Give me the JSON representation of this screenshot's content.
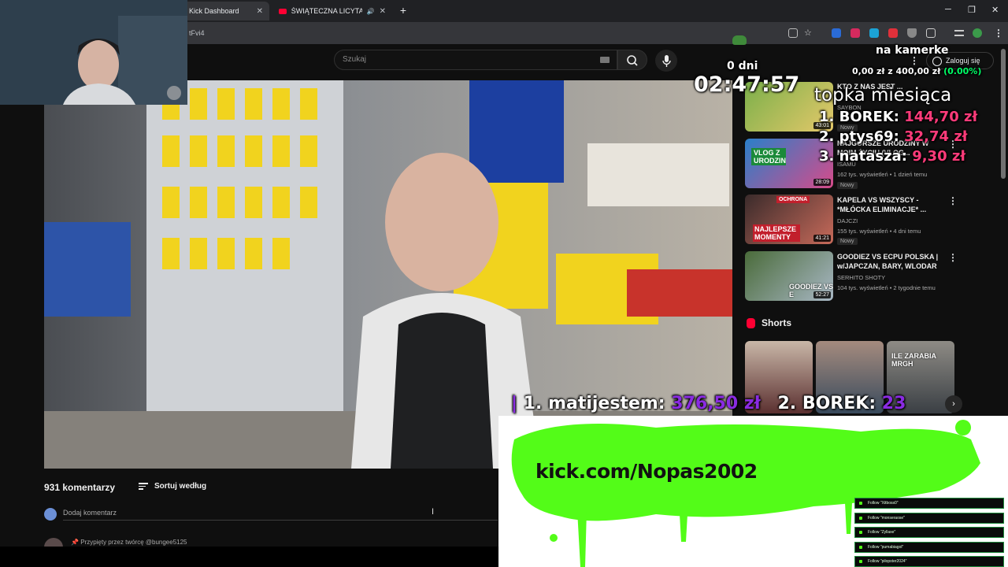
{
  "browser": {
    "tabs": [
      {
        "label": "Kick Dashboard",
        "active": true
      },
      {
        "label": "ŚWIĄTECZNA LICYTACJA P",
        "active": false
      }
    ],
    "address_fragment": "tFvi4"
  },
  "youtube": {
    "search_placeholder": "Szukaj",
    "login_label": "Zaloguj się",
    "comments": {
      "count_label": "931 komentarzy",
      "sort_label": "Sortuj według",
      "add_placeholder": "Dodaj komentarz",
      "pinned_label": "Przypięty przez twórcę @bungee5125"
    },
    "sidebar_videos": [
      {
        "title": "KTO Z NAS JEST ...",
        "channel": "SAYBON",
        "meta": "",
        "badge": "Nowy",
        "duration": "43:01"
      },
      {
        "title": "NAJGORSZE URODZINY W MOIM ŻYCIU (VLOG...",
        "channel": "ISAMU",
        "meta": "162 tys. wyświetleń • 1 dzień temu",
        "badge": "Nowy",
        "duration": "28:09"
      },
      {
        "title": "KAPELA VS WSZYSCY - *MŁÓCKA ELIMINACJE* ...",
        "channel": "DAJCZI",
        "meta": "155 tys. wyświetleń • 4 dni temu",
        "badge": "Nowy",
        "duration": "41:21"
      },
      {
        "title": "GOODIEZ VS ECPU POLSKA | w/JAPCZAN, BARY, WLODAR",
        "channel": "SERHITO SHOTY",
        "meta": "104 tys. wyświetleń • 2 tygodnie temu",
        "badge": "",
        "duration": "52:27"
      }
    ],
    "thumb_texts": [
      "VLOG Z URODZIN",
      "OCHRONA",
      "NAJLEPSZE MOMENTY",
      "GOODIEZ VS E"
    ],
    "shorts_label": "Shorts",
    "short_texts": [
      "",
      "",
      "ILE ZARABIA MRGH"
    ]
  },
  "overlay": {
    "goal_title": "na kamerke",
    "goal_progress": "0,00 zł z 400,00 zł",
    "goal_percent": "(0.00%)",
    "goal_fraction": 0.0,
    "timer_days": "0 dni",
    "timer": "02:47:57",
    "top_title": "topka miesiąca",
    "top_list": [
      {
        "rank": "1.",
        "name": "BOREK:",
        "amount": "144,70 zł"
      },
      {
        "rank": "2.",
        "name": "ptys69:",
        "amount": "32,74 zł"
      },
      {
        "rank": "3.",
        "name": "nataszа:",
        "amount": "9,30 zł"
      }
    ],
    "ticker": [
      {
        "rank": "1.",
        "name": "matijestem:",
        "amount": "376,50 zł"
      },
      {
        "rank": "2.",
        "name": "BOREK:",
        "amount": "23"
      }
    ],
    "kick_url": "kick.com/Nopas2002",
    "follow_feed": [
      "Follow \"Xitboss0\"",
      "Follow \"monseraose\"",
      "Follow \"Zyllaxe\"",
      "Follow \"pumabiagol\"",
      "Follow \"pilopster2024\""
    ]
  },
  "colors": {
    "kick_green": "#53fc18",
    "overlay_green": "#00ff66",
    "overlay_purple": "#8a2be2",
    "overlay_pink": "#ff3b7a",
    "youtube_red": "#ff0033"
  }
}
